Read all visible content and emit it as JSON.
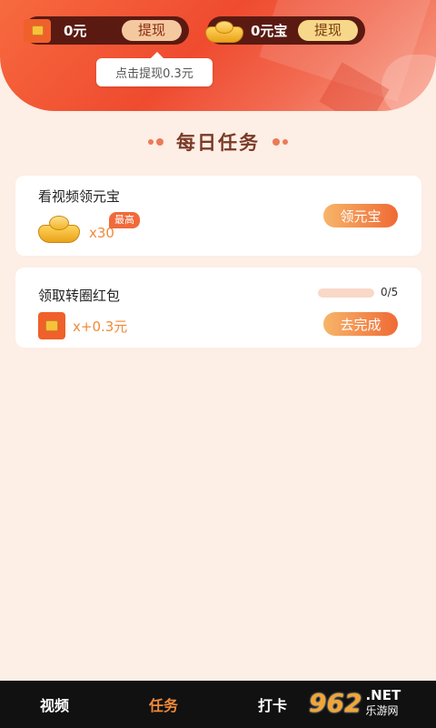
{
  "header": {
    "cash": {
      "value": "0元",
      "withdraw_label": "提现",
      "icon": "red-packet-icon"
    },
    "gold": {
      "value": "0元宝",
      "withdraw_label": "提现",
      "icon": "gold-ingot-icon"
    },
    "tooltip": "点击提现0.3元"
  },
  "section": {
    "title": "每日任务"
  },
  "tasks": [
    {
      "title": "看视频领元宝",
      "reward_icon": "gold-ingot-icon",
      "reward": "x30",
      "badge": "最高",
      "button": "领元宝"
    },
    {
      "title": "领取转圈红包",
      "reward_icon": "red-packet-icon",
      "reward": "x+0.3元",
      "progress_text": "0/5",
      "progress_fraction": 0,
      "button": "去完成"
    }
  ],
  "tabs": [
    {
      "label": "视频",
      "active": false
    },
    {
      "label": "任务",
      "active": true
    },
    {
      "label": "打卡",
      "active": false
    },
    {
      "label": "",
      "active": false
    }
  ],
  "watermark": {
    "number": "962",
    "net": ".NET",
    "sub": "乐游网"
  },
  "colors": {
    "accent": "#ef6a35",
    "header": "#ef4b2f",
    "background": "#fdeee6",
    "tab_active": "#f08a3a",
    "tabbar": "#111111"
  }
}
